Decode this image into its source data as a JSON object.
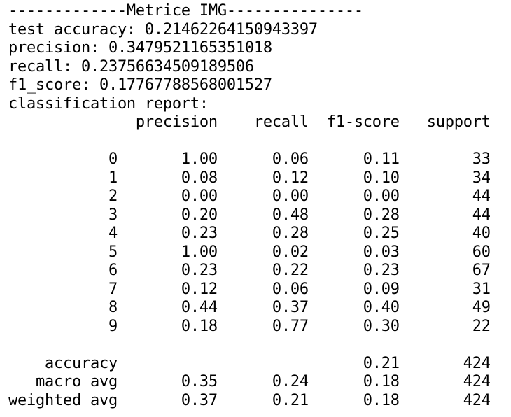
{
  "output": {
    "header_line": "-------------Metrice IMG---------------",
    "metrics": [
      "test accuracy: 0.21462264150943397",
      "precision: 0.3479521165351018",
      "recall: 0.23756634509189506",
      "f1_score: 0.17767788568001527",
      "classification report:"
    ],
    "report_header": "              precision    recall  f1-score   support",
    "class_rows": [
      "           0       1.00      0.06      0.11        33",
      "           1       0.08      0.12      0.10        34",
      "           2       0.00      0.00      0.00        44",
      "           3       0.20      0.48      0.28        44",
      "           4       0.23      0.28      0.25        40",
      "           5       1.00      0.02      0.03        60",
      "           6       0.23      0.22      0.23        67",
      "           7       0.12      0.06      0.09        31",
      "           8       0.44      0.37      0.40        49",
      "           9       0.18      0.77      0.30        22"
    ],
    "summary_rows": [
      "    accuracy                           0.21       424",
      "   macro avg       0.35      0.24      0.18       424",
      "weighted avg       0.37      0.21      0.18       424"
    ]
  }
}
